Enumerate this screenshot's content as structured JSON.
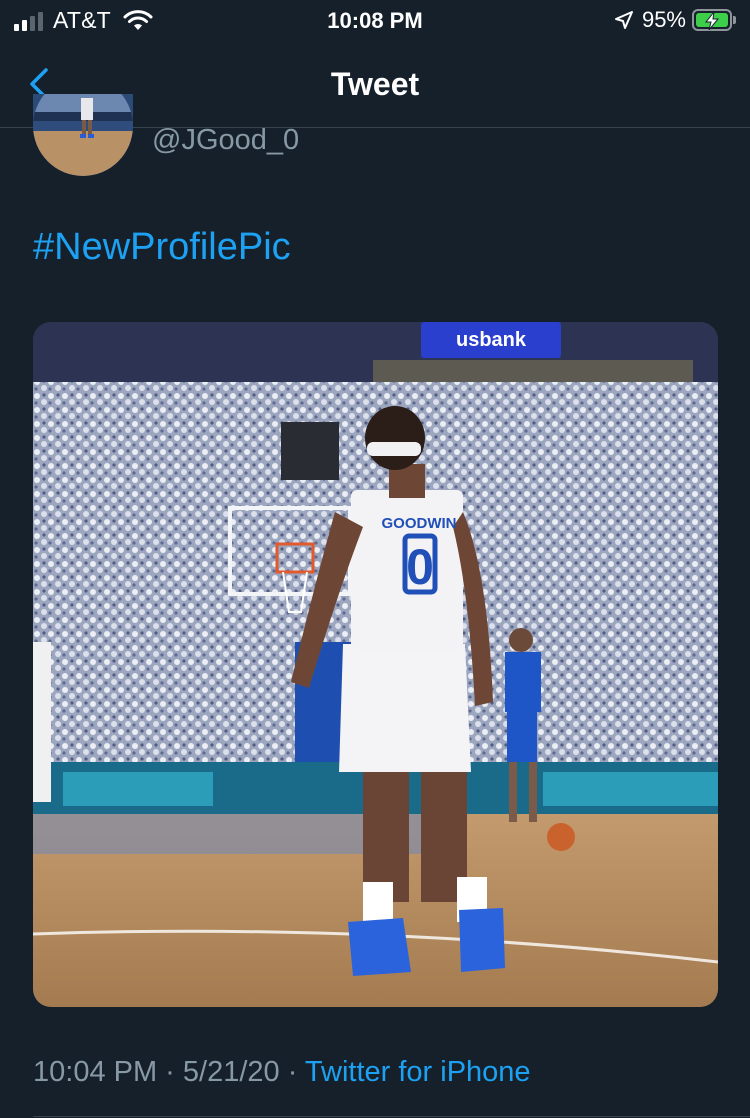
{
  "status_bar": {
    "carrier": "AT&T",
    "time": "10:08 PM",
    "battery_percent": "95%",
    "signal_bars": 4,
    "signal_bars_active": 2,
    "battery_color": "#3ecf4a"
  },
  "nav": {
    "title": "Tweet",
    "back_icon": "chevron-left-icon"
  },
  "author": {
    "handle": "@JGood_0"
  },
  "tweet": {
    "text": "#NewProfilePic",
    "timestamp": "10:04 PM · 5/21/20 · ",
    "source": "Twitter for iPhone"
  },
  "media": {
    "jersey_name": "GOODWIN",
    "jersey_number": "0",
    "banner_text": "usbank"
  },
  "colors": {
    "background": "#15202b",
    "accent": "#1da1f2",
    "secondary_text": "#8899a6",
    "divider": "#38444d"
  }
}
